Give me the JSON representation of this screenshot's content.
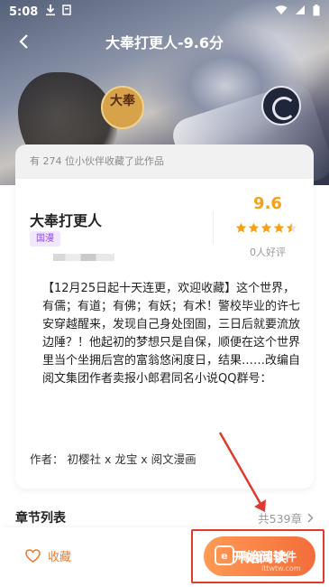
{
  "status_bar": {
    "time": "5:08"
  },
  "header": {
    "title": "大奉打更人-9.6分",
    "back_icon": "back-arrow-icon"
  },
  "cover": {
    "seal_text": "大奉"
  },
  "book": {
    "collect_note": "有 274 位小伙伴收藏了此作品",
    "name": "大奉打更人",
    "tag": "国漫",
    "score": "9.6",
    "stars": 4.5,
    "rating_count": "0人好评",
    "description": "【12月25日起十天连更，欢迎收藏】这个世界，有儒；有道；有佛；有妖；有术！警校毕业的许七安穿越醒来，发现自己身处囹圄，三日后就要流放边陲？！他起初的梦想只是自保，顺便在这个世界里当个坐拥后宫的富翁悠闲度日，结果……改编自阅文集团作者卖报小郎君同名小说QQ群号：",
    "authors": "作者：  初樱社 x 龙宝 x 阅文漫画"
  },
  "chapters": {
    "title": "章节列表",
    "count": "共539章"
  },
  "bottom": {
    "collect_label": "收藏",
    "read_label": "开始阅读"
  },
  "watermark": {
    "brand": "嗨阅读软件",
    "url": "ittwtw.com"
  },
  "colors": {
    "accent": "#f07a2c",
    "score": "#f4a118",
    "tag_text": "#8b48e6",
    "tag_bg": "#f1e6ff",
    "annotation": "#e03a2f"
  }
}
